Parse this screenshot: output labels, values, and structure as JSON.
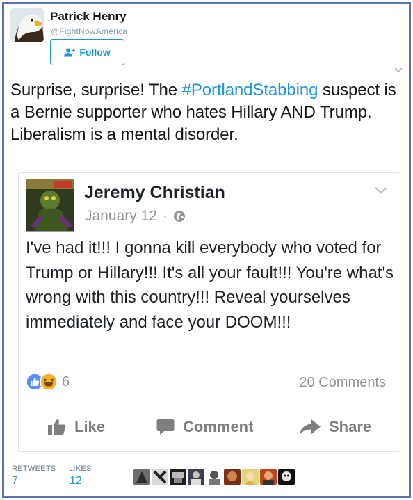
{
  "tweet": {
    "author": {
      "name": "Patrick Henry",
      "handle": "@FightNowAmerica",
      "avatar_icon": "bald-eagle-avatar"
    },
    "follow_label": "Follow",
    "text_before": "Surprise, surprise! The ",
    "hashtag": "#PortlandStabbing",
    "text_after": " suspect is a Bernie supporter who hates Hillary AND Trump. Liberalism is a mental disorder."
  },
  "embedded_post": {
    "author": "Jeremy Christian",
    "date": "January 12",
    "date_separator": "·",
    "text": "I've had it!!! I gonna kill everybody who voted for Trump or Hillary!!! It's all your fault!!! You're what's wrong with this country!!! Reveal yourselves immediately and face your DOOM!!!",
    "reaction_count": "6",
    "comments": "20 Comments",
    "actions": {
      "like": "Like",
      "comment": "Comment",
      "share": "Share"
    }
  },
  "stats": {
    "retweets_label": "RETWEETS",
    "retweets": "7",
    "likes_label": "LIKES",
    "likes": "12"
  },
  "colors": {
    "frame": "#5b72b8",
    "twitter_blue": "#1b95e0",
    "fb_gray": "#90949c",
    "fb_like_blue": "#5890ff",
    "fb_haha_yellow": "#f7b125"
  }
}
